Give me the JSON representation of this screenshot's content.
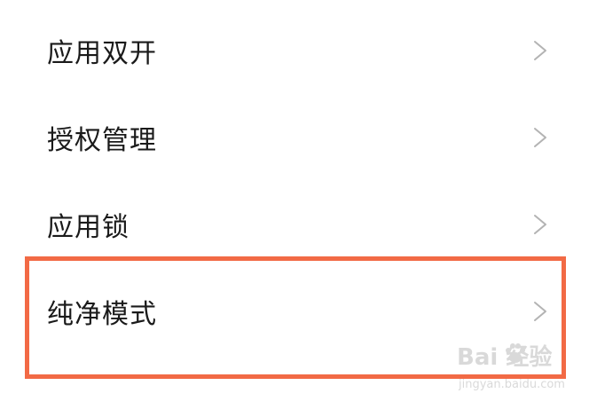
{
  "settings": {
    "items": [
      {
        "label": "应用双开",
        "icon": "chevron-right-icon"
      },
      {
        "label": "授权管理",
        "icon": "chevron-right-icon"
      },
      {
        "label": "应用锁",
        "icon": "chevron-right-icon"
      },
      {
        "label": "纯净模式",
        "icon": "chevron-right-icon"
      }
    ]
  },
  "annotation": {
    "highlight_color": "#f26a45"
  },
  "watermark": {
    "main": "Bai  经验",
    "sub": "jingyan.baidu.com",
    "icon": "paw-icon"
  },
  "colors": {
    "text": "#1a1a1a",
    "chevron": "#b3b3b3",
    "background": "#ffffff"
  }
}
